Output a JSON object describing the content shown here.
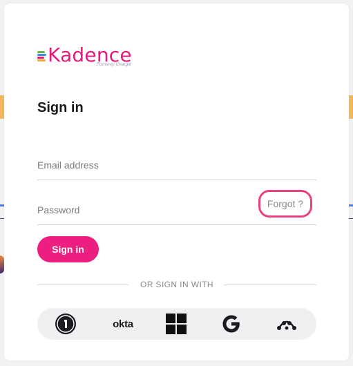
{
  "brand": {
    "name": "Kadence",
    "tagline": "Formerly Chargill",
    "color": "#e8197d",
    "bar_colors": [
      "#6ab04c",
      "#3f8fe0",
      "#e8197d",
      "#f4a836"
    ]
  },
  "form": {
    "title": "Sign in",
    "email_placeholder": "Email address",
    "password_placeholder": "Password",
    "forgot_label": "Forgot ?",
    "submit_label": "Sign in",
    "divider_text": "OR SIGN IN WITH"
  },
  "sso_providers": [
    {
      "name": "1password",
      "icon": "onepassword-icon"
    },
    {
      "name": "okta",
      "label": "okta",
      "icon": "okta-icon"
    },
    {
      "name": "microsoft",
      "icon": "microsoft-icon"
    },
    {
      "name": "google",
      "icon": "google-icon"
    },
    {
      "name": "other",
      "icon": "network-icon"
    }
  ],
  "colors": {
    "accent": "#ec1f80",
    "highlight_ring": "#e8417f"
  }
}
